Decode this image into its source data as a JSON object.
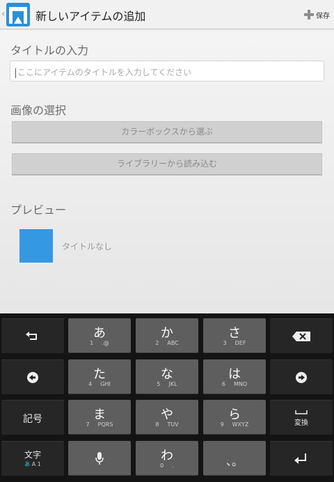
{
  "actionbar": {
    "up": "‹",
    "title": "新しいアイテムの追加",
    "save_label": "保存",
    "accent": "#2d8fd6"
  },
  "form": {
    "title_section": "タイトルの入力",
    "title_placeholder": "ここにアイテムのタイトルを入力してください",
    "image_section": "画像の選択",
    "colorbox_button": "カラーボックスから選ぶ",
    "library_button": "ライブラリーから読み込む",
    "preview_section": "プレビュー",
    "preview_title": "タイトルなし",
    "preview_color": "#3498e3"
  },
  "keyboard": {
    "keys": [
      {
        "main": "あ",
        "num": "1",
        "sub": ".@"
      },
      {
        "main": "か",
        "num": "2",
        "sub": "ABC"
      },
      {
        "main": "さ",
        "num": "3",
        "sub": "DEF"
      },
      {
        "main": "た",
        "num": "4",
        "sub": "GHI"
      },
      {
        "main": "な",
        "num": "5",
        "sub": "JKL"
      },
      {
        "main": "は",
        "num": "6",
        "sub": "MNO"
      },
      {
        "main": "ま",
        "num": "7",
        "sub": "PQRS"
      },
      {
        "main": "や",
        "num": "8",
        "sub": "TUV"
      },
      {
        "main": "ら",
        "num": "9",
        "sub": "WXYZ"
      },
      {
        "main": "わ",
        "num": "0",
        "sub": "."
      }
    ],
    "punct": "、。",
    "symbols": "記号",
    "henkan": "変換",
    "mode": "文字",
    "mode_sub_a": "あ",
    "mode_sub_b": "A 1"
  }
}
